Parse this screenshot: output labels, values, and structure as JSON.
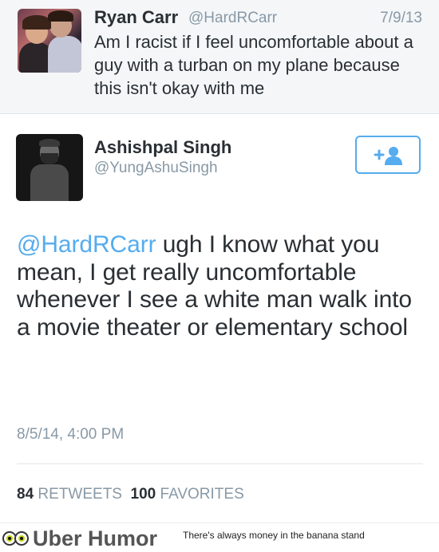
{
  "original_tweet": {
    "name": "Ryan Carr",
    "handle": "@HardRCarr",
    "date": "7/9/13",
    "text": "Am I racist if I feel uncomfortable about a guy with a turban on my plane because this isn't okay with me"
  },
  "reply_tweet": {
    "name": "Ashishpal Singh",
    "handle": "@YungAshuSingh",
    "mention": "@HardRCarr",
    "text": " ugh I know what you mean, I get really uncomfortable whenever I see a white man walk into a movie theater or elementary school",
    "timestamp": "8/5/14, 4:00 PM",
    "follow_icon": "follow-user-icon"
  },
  "stats": {
    "retweets_count": "84",
    "retweets_label": "RETWEETS",
    "favorites_count": "100",
    "favorites_label": "FAVORITES"
  },
  "footer": {
    "brand": "Uber Humor",
    "tagline": "There's always money in the banana stand",
    "logo_icon": "owl-eyes-icon"
  },
  "colors": {
    "link_blue": "#55acee",
    "muted_gray": "#8899a6",
    "text_dark": "#292f33"
  }
}
